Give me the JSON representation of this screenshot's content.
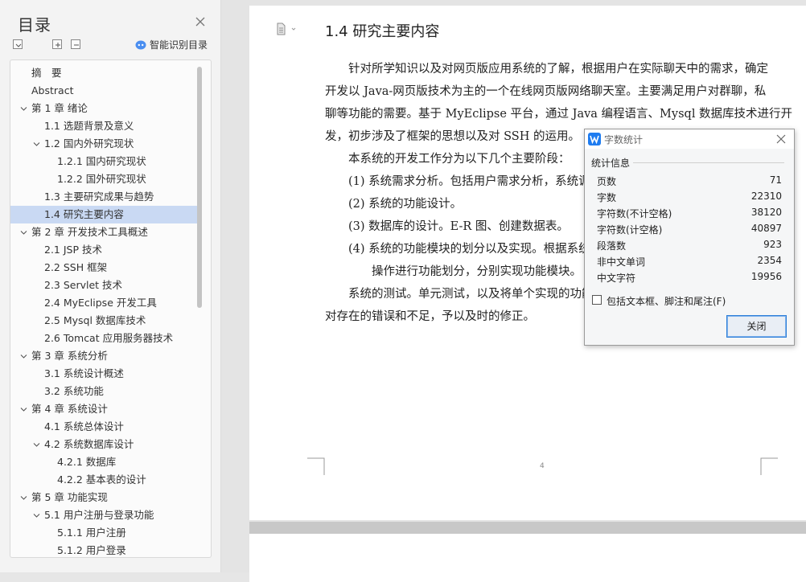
{
  "toc": {
    "title": "目录",
    "ai_toc_label": "智能识别目录",
    "items": [
      {
        "label": "摘　要",
        "level": 0,
        "expandable": false,
        "active": false
      },
      {
        "label": "Abstract",
        "level": 0,
        "expandable": false,
        "active": false
      },
      {
        "label": "第 1 章  绪论",
        "level": 0,
        "expandable": true,
        "active": false
      },
      {
        "label": "1.1 选题背景及意义",
        "level": 1,
        "expandable": false,
        "active": false
      },
      {
        "label": "1.2 国内外研究现状",
        "level": 1,
        "expandable": true,
        "active": false
      },
      {
        "label": "1.2.1  国内研究现状",
        "level": 2,
        "expandable": false,
        "active": false
      },
      {
        "label": "1.2.2  国外研究现状",
        "level": 2,
        "expandable": false,
        "active": false
      },
      {
        "label": "1.3 主要研究成果与趋势",
        "level": 1,
        "expandable": false,
        "active": false
      },
      {
        "label": "1.4 研究主要内容",
        "level": 1,
        "expandable": false,
        "active": true
      },
      {
        "label": "第 2 章  开发技术工具概述",
        "level": 0,
        "expandable": true,
        "active": false
      },
      {
        "label": "2.1 JSP 技术",
        "level": 1,
        "expandable": false,
        "active": false
      },
      {
        "label": "2.2 SSH 框架",
        "level": 1,
        "expandable": false,
        "active": false
      },
      {
        "label": "2.3 Servlet 技术",
        "level": 1,
        "expandable": false,
        "active": false
      },
      {
        "label": "2.4 MyEclipse 开发工具",
        "level": 1,
        "expandable": false,
        "active": false
      },
      {
        "label": "2.5 Mysql 数据库技术",
        "level": 1,
        "expandable": false,
        "active": false
      },
      {
        "label": "2.6 Tomcat 应用服务器技术",
        "level": 1,
        "expandable": false,
        "active": false
      },
      {
        "label": "第 3 章  系统分析",
        "level": 0,
        "expandable": true,
        "active": false
      },
      {
        "label": "3.1 系统设计概述",
        "level": 1,
        "expandable": false,
        "active": false
      },
      {
        "label": "3.2 系统功能",
        "level": 1,
        "expandable": false,
        "active": false
      },
      {
        "label": "第 4 章  系统设计",
        "level": 0,
        "expandable": true,
        "active": false
      },
      {
        "label": "4.1 系统总体设计",
        "level": 1,
        "expandable": false,
        "active": false
      },
      {
        "label": "4.2 系统数据库设计",
        "level": 1,
        "expandable": true,
        "active": false
      },
      {
        "label": "4.2.1 数据库",
        "level": 2,
        "expandable": false,
        "active": false
      },
      {
        "label": "4.2.2 基本表的设计",
        "level": 2,
        "expandable": false,
        "active": false
      },
      {
        "label": "第 5 章  功能实现",
        "level": 0,
        "expandable": true,
        "active": false
      },
      {
        "label": "5.1 用户注册与登录功能",
        "level": 1,
        "expandable": true,
        "active": false
      },
      {
        "label": "5.1.1 用户注册",
        "level": 2,
        "expandable": false,
        "active": false
      },
      {
        "label": "5.1.2 用户登录",
        "level": 2,
        "expandable": false,
        "active": false
      }
    ]
  },
  "document": {
    "heading": "1.4 研究主要内容",
    "paragraph_lines": [
      "　　针对所学知识以及对网页版应用系统的了解，根据用户在实际聊天中的需求，确定",
      "开发以 Java-网页版技术为主的一个在线网页版网络聊天室。主要满足用户对群聊，私",
      "聊等功能的需要。基于 MyEclipse 平台，通过 Java 编程语言、Mysql 数据库技术进行开",
      "发，初步涉及了框架的思想以及对 SSH 的运用。",
      "　　本系统的开发工作分为以下几个主要阶段：",
      "　　(1) 系统需求分析。包括用户需求分析，系统调",
      "　　(2) 系统的功能设计。",
      "　　(3) 数据库的设计。E-R 图、创建数据表。",
      "　　(4) 系统的功能模块的划分以及实现。根据系统",
      "　　　　操作进行功能划分，分别实现功能模块。",
      "　　系统的测试。单元测试，以及将单个实现的功能",
      "对存在的错误和不足，予以及时的修正。"
    ],
    "page_number": "4"
  },
  "word_count": {
    "title": "字数统计",
    "section_label": "统计信息",
    "stats": [
      {
        "label": "页数",
        "value": "71"
      },
      {
        "label": "字数",
        "value": "22310"
      },
      {
        "label": "字符数(不计空格)",
        "value": "38120"
      },
      {
        "label": "字符数(计空格)",
        "value": "40897"
      },
      {
        "label": "段落数",
        "value": "923"
      },
      {
        "label": "非中文单词",
        "value": "2354"
      },
      {
        "label": "中文字符",
        "value": "19956"
      }
    ],
    "include_checkbox_label": "包括文本框、脚注和尾注(F)",
    "include_checked": false,
    "close_button": "关闭"
  }
}
